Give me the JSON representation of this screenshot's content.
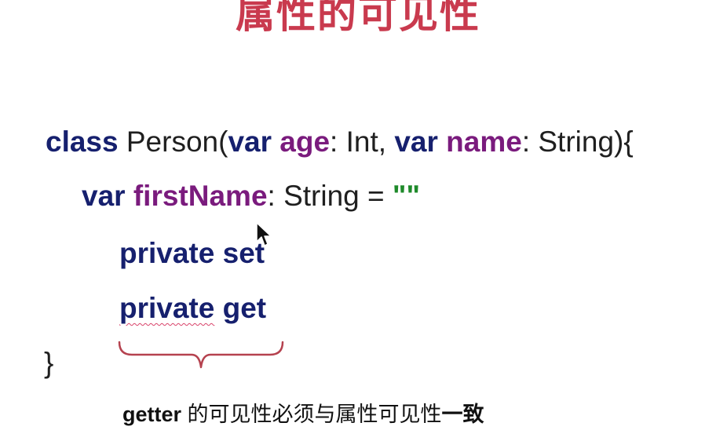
{
  "slide": {
    "title": "属性的可见性"
  },
  "code": {
    "line1": {
      "kw_class": "class",
      "class_name": " Person(",
      "kw_var1": "var",
      "param1": " age",
      "param1_type": ": Int, ",
      "kw_var2": "var",
      "param2": " name",
      "param2_type": ": String){"
    },
    "line2": {
      "kw_var": "var",
      "prop": " firstName",
      "type": ": String = ",
      "value": "\"\""
    },
    "line3": {
      "kw_private": "private",
      "accessor": " set"
    },
    "line4": {
      "kw_private": "private",
      "accessor": " get"
    },
    "line5": {
      "close": "}"
    }
  },
  "annotation": {
    "getter": "getter",
    "middle": " 的可见性必须与属性可见性",
    "emphasis": "一致"
  },
  "colors": {
    "title": "#c93a4e",
    "keyword": "#16206e",
    "property": "#7a1b7d",
    "string": "#1e8a2a",
    "brace": "#b5424f"
  }
}
